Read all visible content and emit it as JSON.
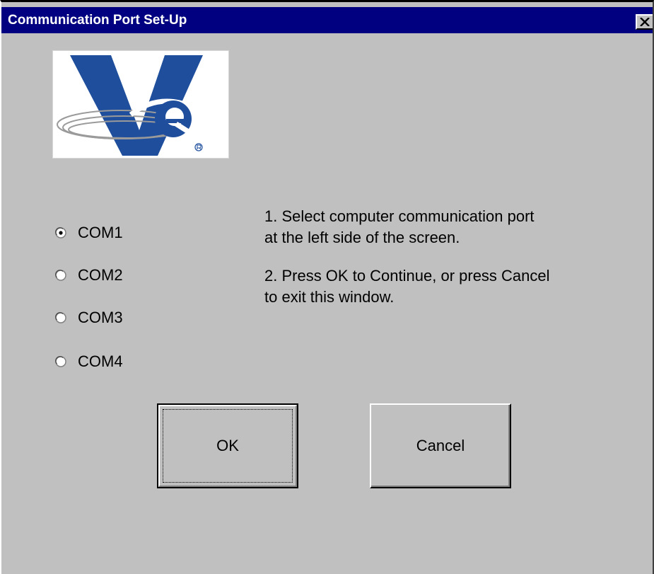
{
  "window": {
    "title": "Communication Port Set-Up",
    "close_label": "×"
  },
  "logo": {
    "name": "company-logo",
    "colors": {
      "blue": "#1e4e9c",
      "white": "#ffffff",
      "gray": "#9a9a9a"
    }
  },
  "ports": [
    {
      "label": "COM1",
      "selected": true
    },
    {
      "label": "COM2",
      "selected": false
    },
    {
      "label": "COM3",
      "selected": false
    },
    {
      "label": "COM4",
      "selected": false
    }
  ],
  "instructions": [
    "1.  Select computer communication port\nat the left side of the screen.",
    "2.  Press OK to Continue, or press Cancel\nto exit this window."
  ],
  "buttons": {
    "ok_label": "OK",
    "cancel_label": "Cancel"
  },
  "colors": {
    "titlebar": "#000080",
    "face": "#c0c0c0",
    "title_text": "#ffffff"
  }
}
